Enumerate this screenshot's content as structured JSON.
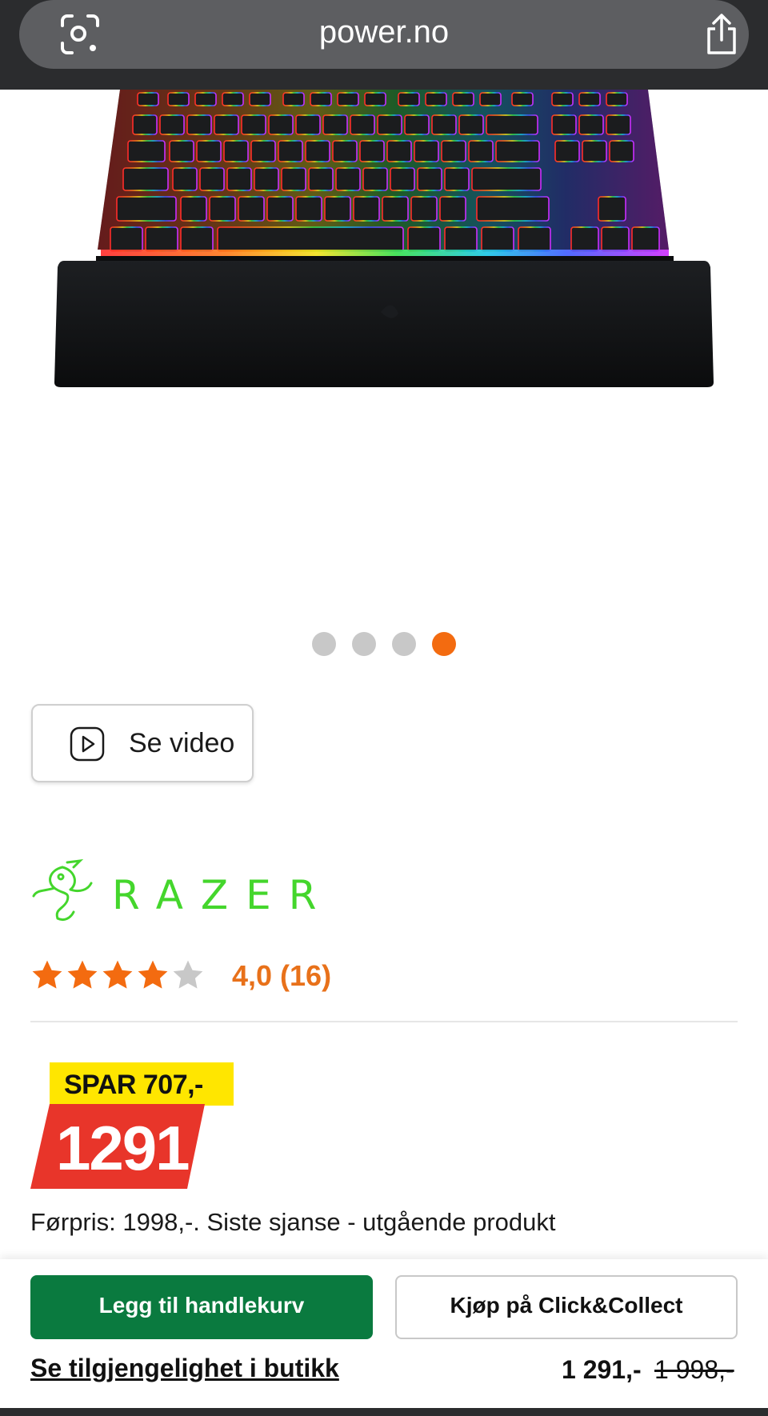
{
  "browser": {
    "url": "power.no",
    "left_icon": "visual-lookup-icon",
    "right_icon": "share-icon"
  },
  "product_image": {
    "subject": "keyboard-with-wrist-rest"
  },
  "carousel": {
    "dot_count": 4,
    "active_index": 3,
    "active_color": "#f36b10",
    "inactive_color": "#c8c8c8"
  },
  "video": {
    "label": "Se video",
    "icon": "play-icon"
  },
  "brand": {
    "name": "RAZER",
    "color": "#44d62c"
  },
  "rating": {
    "value": 4.0,
    "max": 5,
    "text": "4,0 (16)",
    "star_color": "#f36b10",
    "empty_color": "#c8c8c8"
  },
  "price": {
    "save_label": "SPAR 707,-",
    "current": "1291",
    "save_color": "#ffe600",
    "price_color": "#e8352a",
    "note": "Førpris: 1998,-. Siste sjanse - utgående produkt"
  },
  "bottom": {
    "cart_label": "Legg til handlekurv",
    "click_collect_label": "Kjøp på Click&Collect",
    "availability_label": "Se tilgjengelighet i butikk",
    "price": "1 291,-",
    "old_price": "1 998,-",
    "cart_color": "#0a7a3f"
  }
}
